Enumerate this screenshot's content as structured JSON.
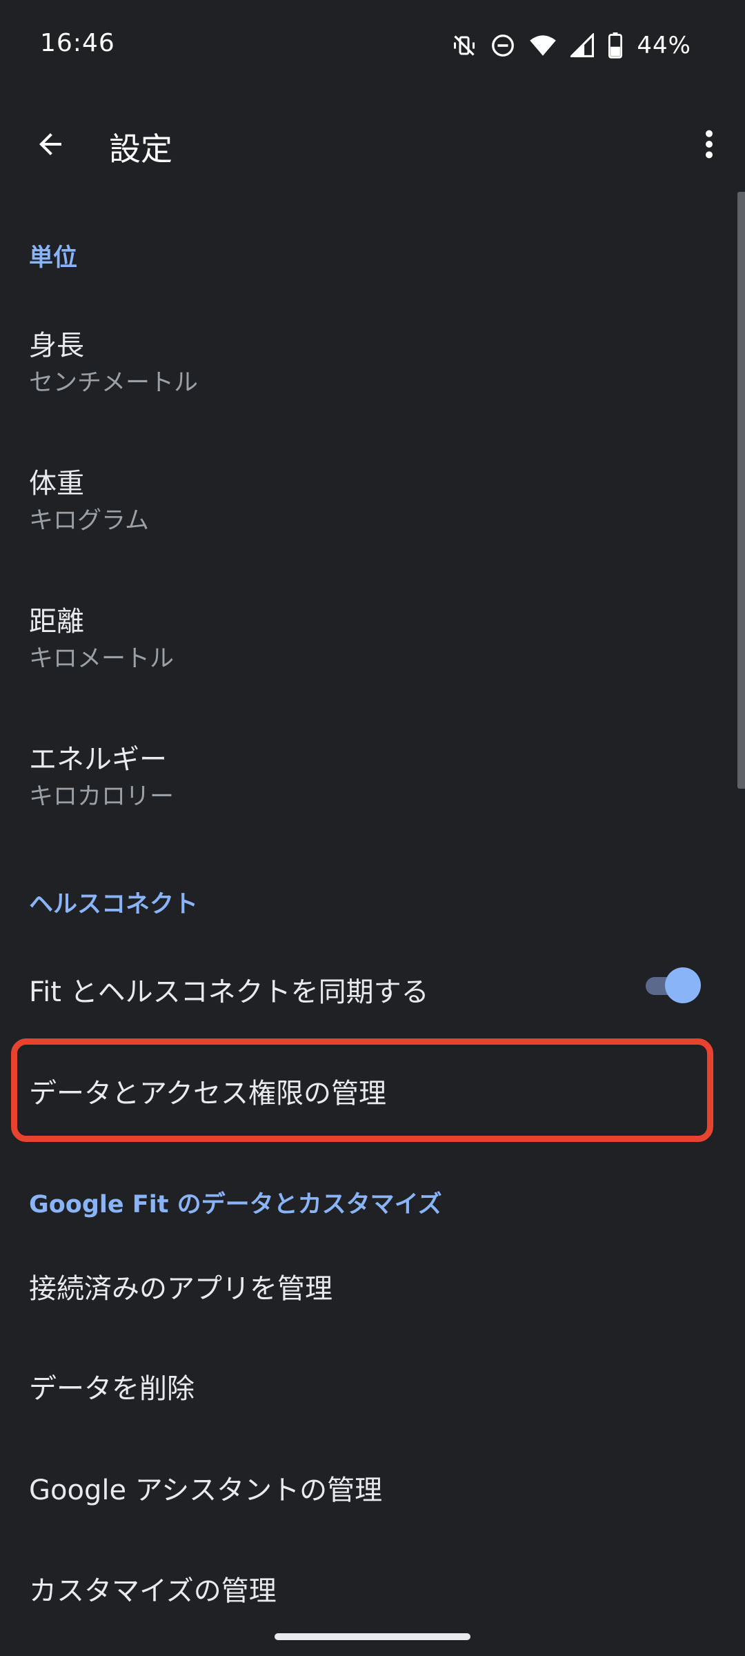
{
  "status_bar": {
    "time": "16:46",
    "battery_percent": "44%",
    "icons": [
      "vibrate-off-icon",
      "dnd-icon",
      "wifi-icon",
      "cellular-signal-icon",
      "battery-icon"
    ]
  },
  "app_bar": {
    "title": "設定",
    "back_icon": "arrow-back-icon",
    "more_icon": "more-vert-icon"
  },
  "sections": {
    "units": {
      "header": "単位",
      "items": [
        {
          "title": "身長",
          "value": "センチメートル"
        },
        {
          "title": "体重",
          "value": "キログラム"
        },
        {
          "title": "距離",
          "value": "キロメートル"
        },
        {
          "title": "エネルギー",
          "value": "キロカロリー"
        }
      ]
    },
    "health_connect": {
      "header": "ヘルスコネクト",
      "sync_label": "Fit とヘルスコネクトを同期する",
      "sync_enabled": true,
      "manage_label": "データとアクセス権限の管理"
    },
    "google_fit": {
      "header": "Google Fit のデータとカスタマイズ",
      "items": [
        {
          "title": "接続済みのアプリを管理"
        },
        {
          "title": "データを削除"
        },
        {
          "title": "Google アシスタントの管理"
        },
        {
          "title": "カスタマイズの管理"
        }
      ]
    }
  },
  "colors": {
    "background": "#202124",
    "accent": "#8ab4f8",
    "highlight": "#e8432e",
    "primary_text": "#e8eaed",
    "secondary_text": "#9aa0a6"
  }
}
